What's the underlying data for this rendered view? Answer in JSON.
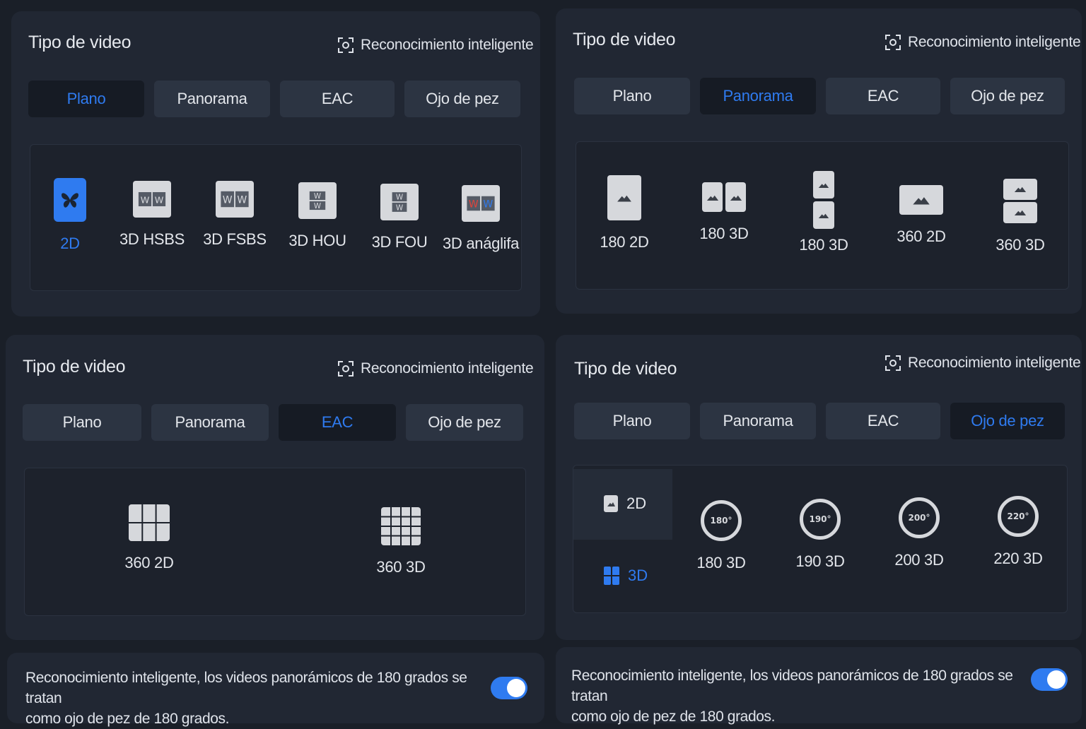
{
  "colors": {
    "accent": "#2f7bf0",
    "panel": "#212733",
    "tab": "#2c3442",
    "active_tab": "#161b24"
  },
  "panels": [
    {
      "title": "Tipo de video",
      "smart": "Reconocimiento inteligente",
      "tabs": [
        "Plano",
        "Panorama",
        "EAC",
        "Ojo de pez"
      ],
      "active_tab": "Plano",
      "options": [
        {
          "label": "2D",
          "icon": "butterfly-icon",
          "selected": true
        },
        {
          "label": "3D HSBS",
          "icon": "half-side-by-side-icon"
        },
        {
          "label": "3D FSBS",
          "icon": "full-side-by-side-icon"
        },
        {
          "label": "3D HOU",
          "icon": "half-over-under-icon"
        },
        {
          "label": "3D FOU",
          "icon": "full-over-under-icon"
        },
        {
          "label": "3D anáglifa",
          "icon": "anaglyph-icon"
        }
      ]
    },
    {
      "title": "Tipo de video",
      "smart": "Reconocimiento inteligente",
      "tabs": [
        "Plano",
        "Panorama",
        "EAC",
        "Ojo de pez"
      ],
      "active_tab": "Panorama",
      "options": [
        {
          "label": "180 2D",
          "icon": "landscape-square-icon"
        },
        {
          "label": "180 3D",
          "icon": "landscape-side-by-side-icon"
        },
        {
          "label": "180 3D",
          "icon": "landscape-over-under-icon"
        },
        {
          "label": "360 2D",
          "icon": "landscape-wide-icon"
        },
        {
          "label": "360 3D",
          "icon": "landscape-stacked-icon"
        }
      ]
    },
    {
      "title": "Tipo de video",
      "smart": "Reconocimiento inteligente",
      "tabs": [
        "Plano",
        "Panorama",
        "EAC",
        "Ojo de pez"
      ],
      "active_tab": "EAC",
      "options": [
        {
          "label": "360 2D",
          "icon": "cube-grid-2x3-icon"
        },
        {
          "label": "360 3D",
          "icon": "cube-grid-4x3-icon"
        }
      ]
    },
    {
      "title": "Tipo de video",
      "smart": "Reconocimiento inteligente",
      "tabs": [
        "Plano",
        "Panorama",
        "EAC",
        "Ojo de pez"
      ],
      "active_tab": "Ojo de pez",
      "side": [
        {
          "label": "2D",
          "icon": "single-frame-icon"
        },
        {
          "label": "3D",
          "icon": "dual-frame-icon",
          "selected": true
        }
      ],
      "options": [
        {
          "label": "180 3D",
          "badge": "180°"
        },
        {
          "label": "190 3D",
          "badge": "190°"
        },
        {
          "label": "200 3D",
          "badge": "200°"
        },
        {
          "label": "220 3D",
          "badge": "220°"
        }
      ]
    }
  ],
  "bottom": {
    "line1": "Reconocimiento inteligente, los videos panorámicos de 180 grados se tratan",
    "line2": "como ojo de pez de 180 grados.",
    "toggle_on": true
  }
}
